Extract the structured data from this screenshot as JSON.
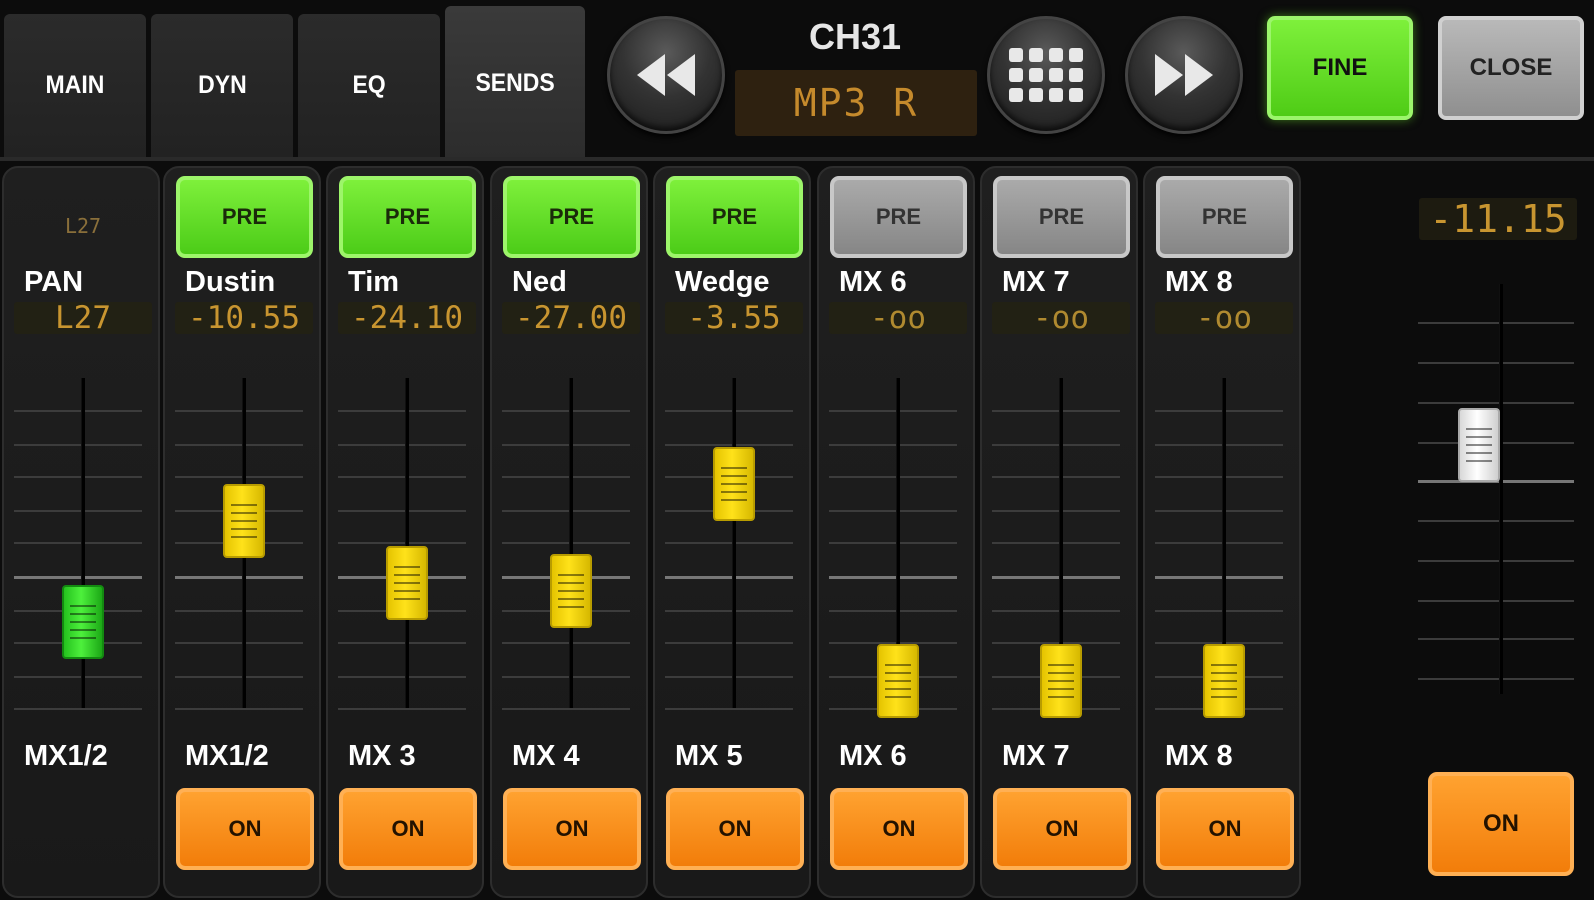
{
  "tabs": [
    "MAIN",
    "DYN",
    "EQ",
    "SENDS"
  ],
  "active_tab": "SENDS",
  "header": {
    "channel": "CH31",
    "channel_name": "MP3 R",
    "fine_label": "FINE",
    "close_label": "CLOSE"
  },
  "pan_strip": {
    "small_value": "L27",
    "name": "PAN",
    "value": "L27",
    "bus": "MX1/2",
    "fader_level": 0.22
  },
  "sends": [
    {
      "pre": "PRE",
      "pre_active": true,
      "name": "Dustin",
      "value": "-10.55",
      "bus": "MX1/2",
      "on": "ON",
      "fader_level": 0.6
    },
    {
      "pre": "PRE",
      "pre_active": true,
      "name": "Tim",
      "value": "-24.10",
      "bus": "MX 3",
      "on": "ON",
      "fader_level": 0.37
    },
    {
      "pre": "PRE",
      "pre_active": true,
      "name": "Ned",
      "value": "-27.00",
      "bus": "MX 4",
      "on": "ON",
      "fader_level": 0.34
    },
    {
      "pre": "PRE",
      "pre_active": true,
      "name": "Wedge",
      "value": "-3.55",
      "bus": "MX 5",
      "on": "ON",
      "fader_level": 0.74
    },
    {
      "pre": "PRE",
      "pre_active": false,
      "name": "MX 6",
      "value": "-oo",
      "bus": "MX 6",
      "on": "ON",
      "fader_level": 0.0
    },
    {
      "pre": "PRE",
      "pre_active": false,
      "name": "MX 7",
      "value": "-oo",
      "bus": "MX 7",
      "on": "ON",
      "fader_level": 0.0
    },
    {
      "pre": "PRE",
      "pre_active": false,
      "name": "MX 8",
      "value": "-oo",
      "bus": "MX 8",
      "on": "ON",
      "fader_level": 0.0
    }
  ],
  "master": {
    "value": "-11.15",
    "on": "ON",
    "fader_level": 0.63
  },
  "icons": {
    "rewind": "rewind-icon",
    "grid": "grid-icon",
    "forward": "fast-forward-icon"
  },
  "colors": {
    "active_green": "#5fdc22",
    "on_orange": "#f58a14",
    "fader_yellow": "#f5d800",
    "value_amber": "#c89530"
  }
}
